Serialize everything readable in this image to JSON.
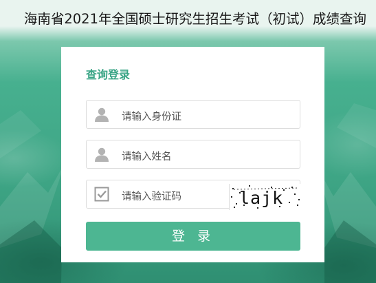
{
  "page_title": "海南省2021年全国硕士研究生招生考试（初试）成绩查询",
  "login": {
    "heading": "查询登录",
    "id_field": {
      "placeholder": "请输入身份证",
      "icon": "user-icon"
    },
    "name_field": {
      "placeholder": "请输入姓名",
      "icon": "user-icon"
    },
    "captcha_field": {
      "placeholder": "请输入验证码",
      "icon": "checkbox-icon"
    },
    "captcha_text": "lajk",
    "submit_label": "登 录"
  },
  "colors": {
    "accent": "#3aa586",
    "button": "#4db692",
    "background": "#3aa988"
  }
}
